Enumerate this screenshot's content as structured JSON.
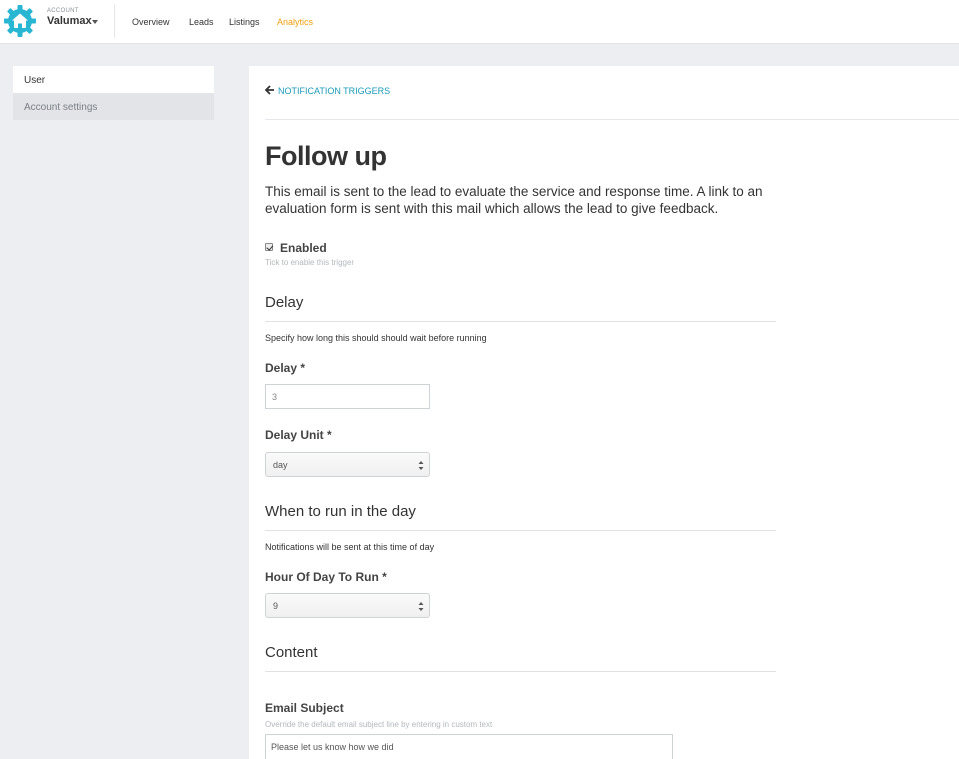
{
  "header": {
    "account_caption": "ACCOUNT",
    "account_name": "Valumax",
    "nav": [
      "Overview",
      "Leads",
      "Listings",
      "Analytics"
    ],
    "active_nav": "Analytics",
    "accent_color": "#f0a012",
    "logo_color": "#29b6d3"
  },
  "sidebar": {
    "items": [
      {
        "label": "User"
      },
      {
        "label": "Account settings"
      }
    ]
  },
  "main": {
    "back_label": "NOTIFICATION TRIGGERS",
    "title": "Follow up",
    "description": "This email is sent to the lead to evaluate the service and response time. A link to an evaluation form is sent with this mail which allows the lead to give feedback.",
    "enabled": {
      "checked": true,
      "label": "Enabled",
      "hint": "Tick to enable this trigger"
    },
    "delay_section": {
      "title": "Delay",
      "help": "Specify how long this should should wait before running",
      "delay_label": "Delay",
      "delay_value": "3",
      "unit_label": "Delay Unit",
      "unit_value": "day"
    },
    "time_section": {
      "title": "When to run in the day",
      "help": "Notifications will be sent at this time of day",
      "hour_label": "Hour Of Day To Run",
      "hour_value": "9"
    },
    "content_section": {
      "title": "Content",
      "subject_label": "Email Subject",
      "subject_hint": "Override the default email subject line by entering in custom text",
      "subject_value": "Please let us know how we did"
    },
    "required_marker": "*"
  }
}
